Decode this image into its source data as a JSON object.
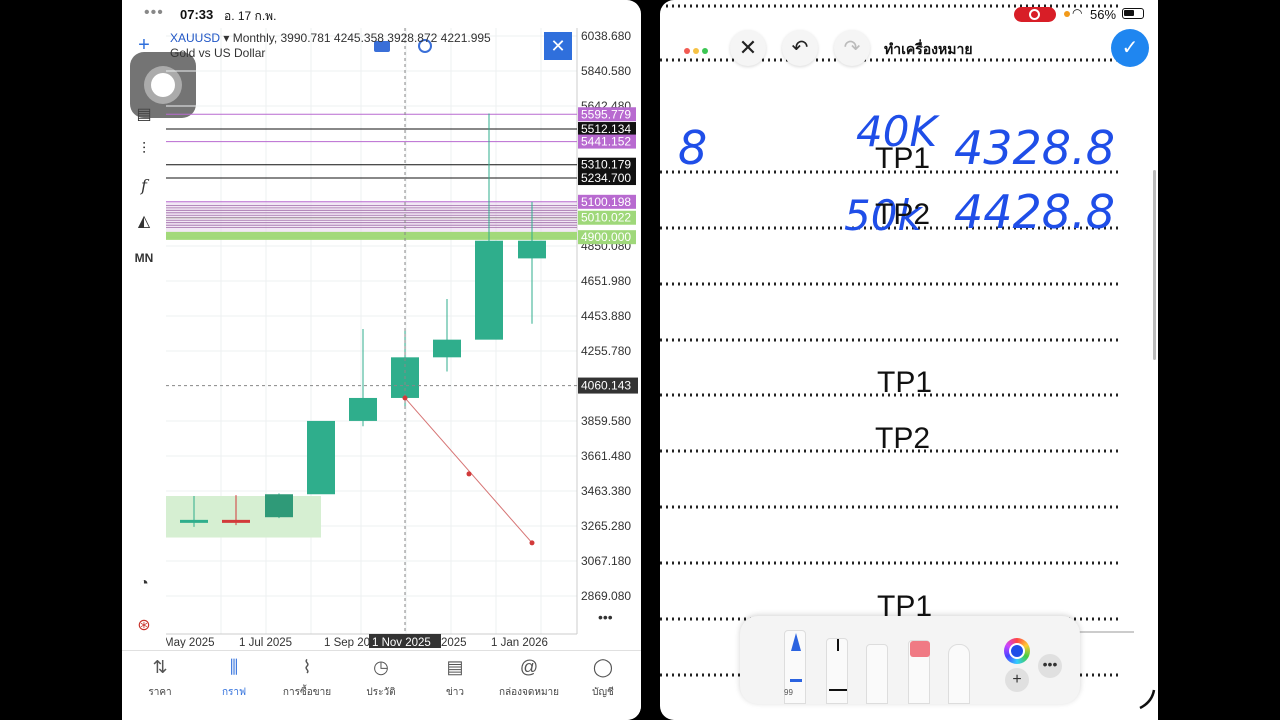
{
  "left_app": {
    "status": {
      "dots": "•••",
      "time": "07:33",
      "date": "อ. 17 ก.พ."
    },
    "chart": {
      "symbol": "XAUUSD",
      "info": "▾ Monthly, 3990.781 4245.358 3928.872 4221.995",
      "description": "Gold vs US Dollar",
      "price_ticks": [
        "6038.680",
        "5840.580",
        "5642.480",
        "4850.080",
        "4651.980",
        "4453.880",
        "4255.780",
        "3859.580",
        "3661.480",
        "3463.380",
        "3265.280",
        "3067.180",
        "2869.080"
      ],
      "price_tags": [
        {
          "value": "5595.779",
          "color": "#b86ad0"
        },
        {
          "value": "5512.134",
          "color": "#111111"
        },
        {
          "value": "5441.152",
          "color": "#b86ad0"
        },
        {
          "value": "5310.179",
          "color": "#111111"
        },
        {
          "value": "5234.700",
          "color": "#111111"
        },
        {
          "value": "5100.198",
          "color": "#b86ad0"
        },
        {
          "value": "5010.022",
          "color": "#9fd87a"
        },
        {
          "value": "4900.000",
          "color": "#9fd87a"
        }
      ],
      "crosshair_price": "4060.143",
      "date_labels": [
        "May 2025",
        "1 Jul 2025",
        "1 Sep 20",
        "1 Nov 2025",
        "2025",
        "1 Jan 2026"
      ],
      "highlighted_date": "1 Nov 2025",
      "candles": [
        {
          "open": 3290,
          "high": 3435,
          "low": 3260,
          "close": 3300
        },
        {
          "open": 3300,
          "high": 3440,
          "low": 3270,
          "close": 3290
        },
        {
          "open": 3315,
          "high": 3450,
          "low": 3310,
          "close": 3445
        },
        {
          "open": 3445,
          "high": 3760,
          "low": 3450,
          "close": 3860
        },
        {
          "open": 3860,
          "high": 4380,
          "low": 3830,
          "close": 3990
        },
        {
          "open": 3990,
          "high": 4380,
          "low": 3930,
          "close": 4220
        },
        {
          "open": 4220,
          "high": 4550,
          "low": 4140,
          "close": 4320
        },
        {
          "open": 4320,
          "high": 5600,
          "low": 4330,
          "close": 4880
        },
        {
          "open": 4780,
          "high": 5100,
          "low": 4410,
          "close": 4880
        }
      ]
    },
    "tabs": [
      {
        "label": "ราคา",
        "icon": "quotes-icon"
      },
      {
        "label": "กราฟ",
        "icon": "chart-icon"
      },
      {
        "label": "การซื้อขาย",
        "icon": "trade-icon"
      },
      {
        "label": "ประวัติ",
        "icon": "history-icon"
      },
      {
        "label": "ข่าว",
        "icon": "news-icon"
      },
      {
        "label": "กล่องจดหมาย",
        "icon": "mailbox-icon"
      },
      {
        "label": "บัญชี",
        "icon": "account-icon"
      }
    ],
    "toolbar_labels": {
      "function": "f",
      "timeframe": "MN"
    }
  },
  "right_app": {
    "status": {
      "battery": "56%"
    },
    "markup": {
      "title": "ทำเครื่องหมาย"
    },
    "template_labels": [
      "TP1",
      "TP2",
      "TP1",
      "TP2",
      "TP1"
    ],
    "handwriting": {
      "left_number": "8",
      "row1_qty": "40K",
      "row1_price": "4328.8",
      "row2_qty": "50k",
      "row2_price": "4428.8"
    },
    "pen_count": "99",
    "colors": {
      "ink": "#1f4ee8",
      "done": "#1f86f0"
    }
  }
}
